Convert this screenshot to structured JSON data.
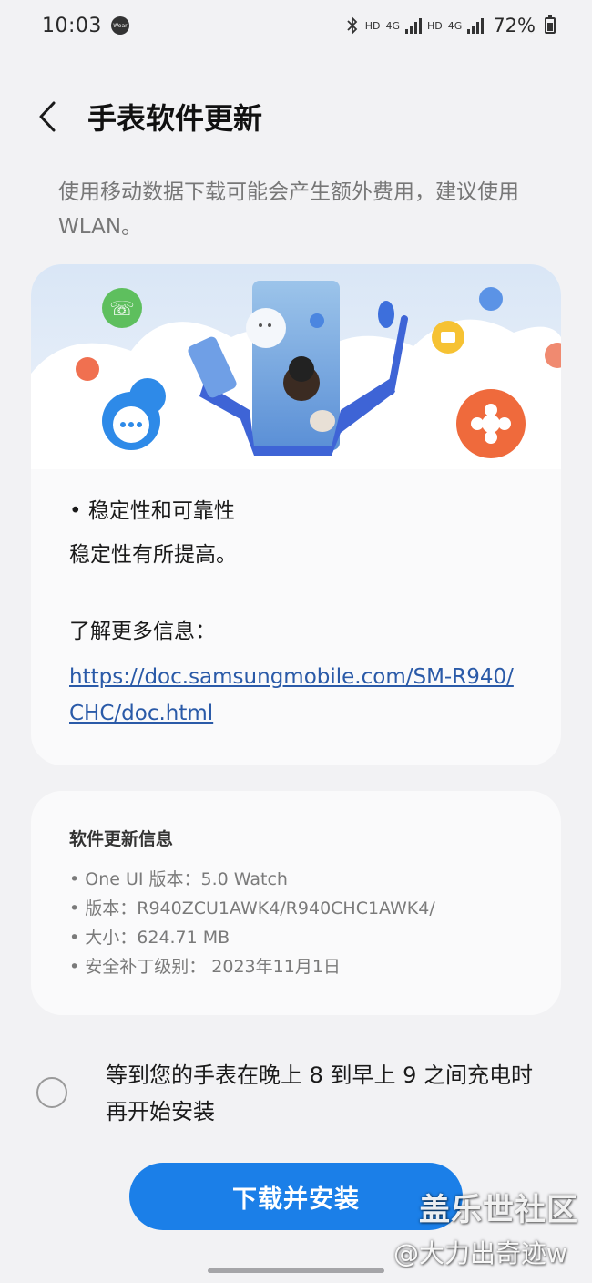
{
  "status_bar": {
    "time": "10:03",
    "wear_badge": "Wear",
    "bluetooth_icon": "bluetooth-icon",
    "net1_hd": "HD",
    "net1_4g": "4G",
    "net2_hd": "HD",
    "net2_4g": "4G",
    "battery": "72%"
  },
  "header": {
    "back_icon": "back-arrow-icon",
    "title": "手表软件更新"
  },
  "notice": "使用移动数据下载可能会产生额外费用，建议使用 WLAN。",
  "release_notes": {
    "bullet_title": "• 稳定性和可靠性",
    "bullet_desc": "稳定性有所提高。",
    "learn_more": "了解更多信息：",
    "link": "https://doc.samsungmobile.com/SM-R940/CHC/doc.html"
  },
  "software_info": {
    "title": "软件更新信息",
    "lines": [
      "• One UI 版本：5.0 Watch",
      "• 版本：R940ZCU1AWK4/R940CHC1AWK4/",
      "• 大小：624.71 MB",
      "• 安全补丁级别： 2023年11月1日"
    ]
  },
  "option": {
    "label": "等到您的手表在晚上 8 到早上 9 之间充电时再开始安装",
    "checked": false
  },
  "primary_button": "下载并安装",
  "watermark": {
    "line1": "盖乐世社区",
    "line2": "@大力出奇迹w"
  },
  "colors": {
    "accent": "#1b7fe8",
    "link": "#2a5aa8",
    "background": "#f2f2f4",
    "card": "#fafafb"
  }
}
